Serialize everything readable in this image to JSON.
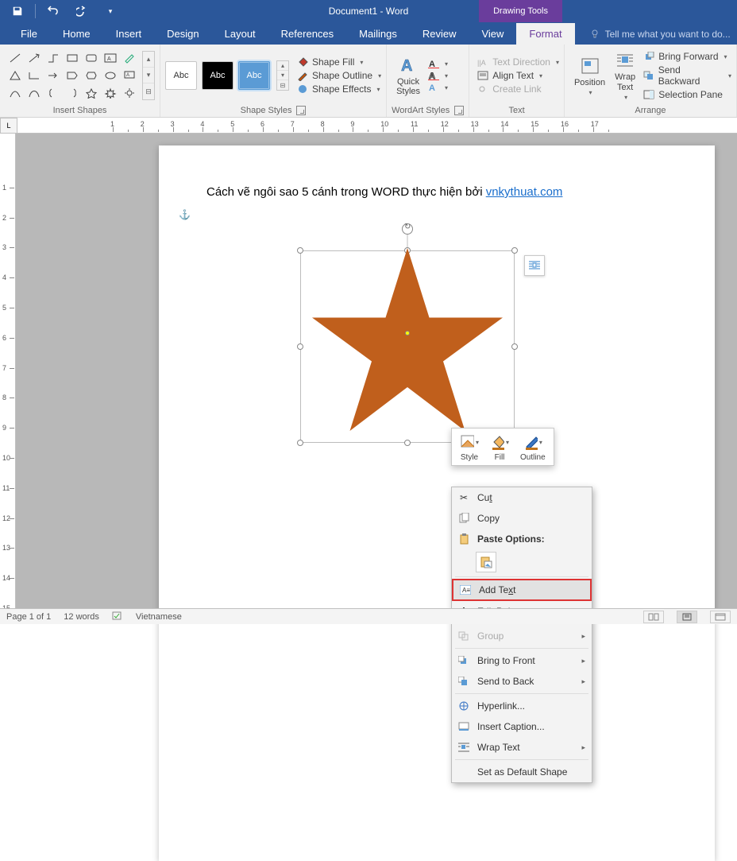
{
  "title": "Document1 - Word",
  "drawing_tools": "Drawing Tools",
  "tabs": {
    "file": "File",
    "home": "Home",
    "insert": "Insert",
    "design": "Design",
    "layout": "Layout",
    "references": "References",
    "mailings": "Mailings",
    "review": "Review",
    "view": "View",
    "format": "Format"
  },
  "tellme": "Tell me what you want to do...",
  "ribbon": {
    "insert_shapes": "Insert Shapes",
    "shape_styles": "Shape Styles",
    "shape_fill": "Shape Fill",
    "shape_outline": "Shape Outline",
    "shape_effects": "Shape Effects",
    "style_swatch": "Abc",
    "wordart_styles": "WordArt Styles",
    "quick_styles": "Quick\nStyles",
    "text": "Text",
    "text_direction": "Text Direction",
    "align_text": "Align Text",
    "create_link": "Create Link",
    "arrange": "Arrange",
    "position": "Position",
    "wrap_text": "Wrap\nText",
    "bring_forward": "Bring Forward",
    "send_backward": "Send Backward",
    "selection_pane": "Selection Pane"
  },
  "document": {
    "text_prefix": "Cách vẽ ngôi sao 5 cánh trong WORD thực hiện bởi ",
    "link_text": "vnkythuat.com"
  },
  "mini_toolbar": {
    "style": "Style",
    "fill": "Fill",
    "outline": "Outline"
  },
  "context_menu": {
    "cut": "Cut",
    "copy": "Copy",
    "paste_options": "Paste Options:",
    "add_text": "Add Text",
    "edit_points": "Edit Points",
    "group": "Group",
    "bring_to_front": "Bring to Front",
    "send_to_back": "Send to Back",
    "hyperlink": "Hyperlink...",
    "insert_caption": "Insert Caption...",
    "wrap_text": "Wrap Text",
    "set_default": "Set as Default Shape"
  },
  "status": {
    "page": "Page 1 of 1",
    "words": "12 words",
    "language": "Vietnamese"
  },
  "ruler_nums": [
    "1",
    "2",
    "3",
    "4",
    "5",
    "6",
    "7",
    "8",
    "9",
    "10",
    "11",
    "12",
    "13",
    "14",
    "15",
    "16",
    "17"
  ]
}
